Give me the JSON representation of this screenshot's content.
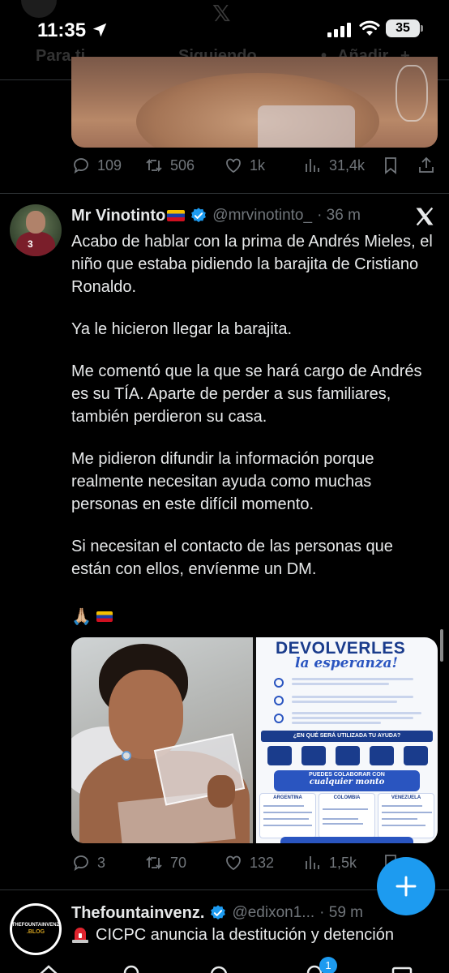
{
  "status_bar": {
    "time": "11:35",
    "battery": "35"
  },
  "tabs": {
    "for_you": "Para ti",
    "following": "Siguiendo",
    "add": "Añadir"
  },
  "prev_tweet": {
    "stats": {
      "replies": "109",
      "reposts": "506",
      "likes": "1k",
      "views": "31,4k"
    }
  },
  "tweet": {
    "name": "Mr Vinotinto",
    "handle": "@mrvinotinto_",
    "time": "· 36 m",
    "paragraphs": [
      "Acabo de hablar con la prima de Andrés Mieles, el niño que estaba pidiendo la barajita de Cristiano Ronaldo.",
      "Ya le hicieron llegar la barajita.",
      "Me comentó que la que se hará cargo de Andrés es su TÍA. Aparte de perder a sus familiares, también perdieron su casa.",
      "Me pidieron difundir la información porque realmente necesitan ayuda como muchas personas en este difícil momento.",
      "Si necesitan el contacto de las personas que están con ellos, envíenme un DM."
    ],
    "emoji": "🙏🏼",
    "flyer": {
      "title": "DEVOLVERLES",
      "subtitle": "la esperanza!",
      "question": "¿EN QUÉ SERÁ UTILIZADA TU AYUDA?",
      "collab_1": "PUEDES COLABORAR CON",
      "collab_2": "cualquier monto",
      "countries": [
        "ARGENTINA",
        "COLOMBIA",
        "VENEZUELA"
      ]
    },
    "stats": {
      "replies": "3",
      "reposts": "70",
      "likes": "132",
      "views": "1,5k"
    }
  },
  "tweet2": {
    "name": "Thefountainvenz.",
    "handle": "@edixon1...",
    "time": "· 59 m",
    "text": "CICPC anuncia la destitución y detención",
    "avatar_top": "THEFOUNTAINVENZ",
    "avatar_bottom": ".BLOG"
  },
  "nav": {
    "notifications_badge": "1"
  },
  "colors": {
    "accent": "#1d9bf0",
    "background": "#000000",
    "text": "#e7e9ea",
    "muted": "#71767b"
  }
}
